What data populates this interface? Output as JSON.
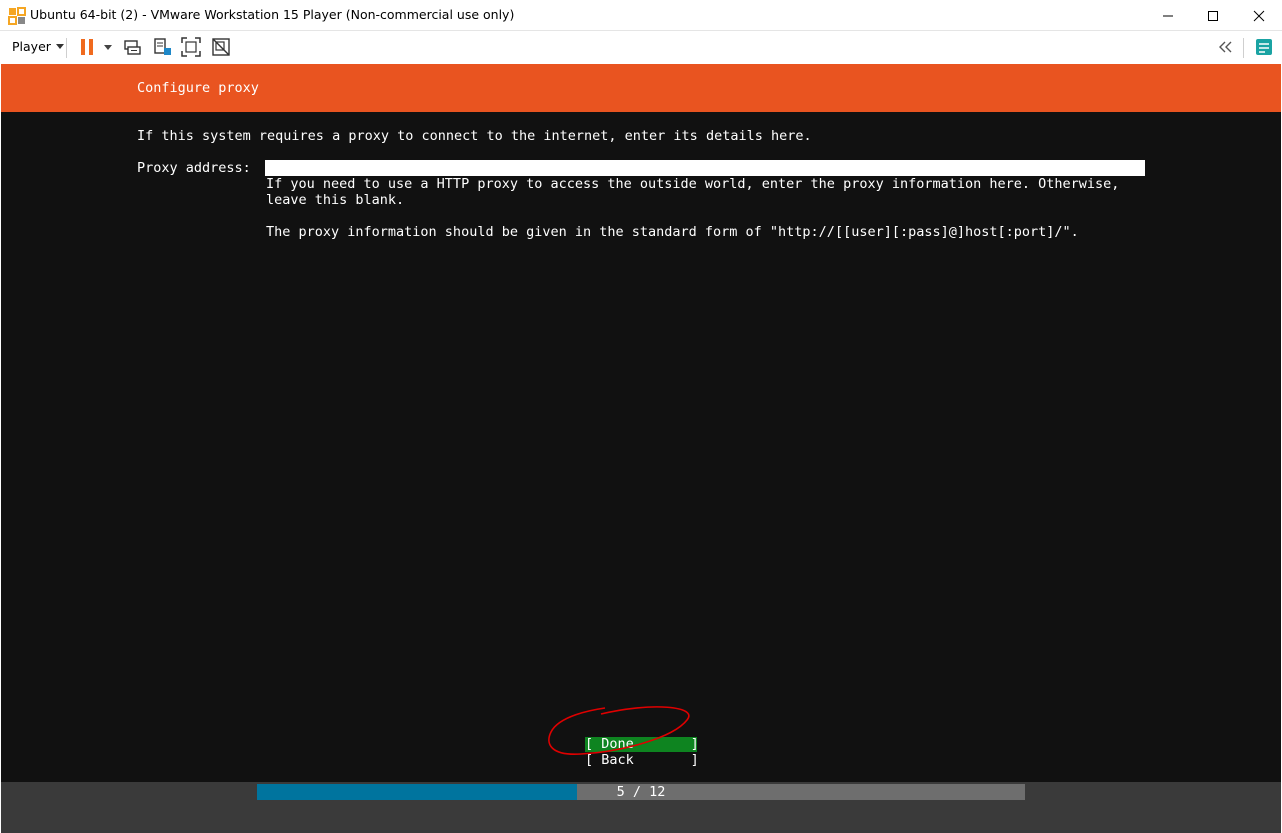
{
  "window": {
    "title": "Ubuntu 64-bit (2) - VMware Workstation 15 Player (Non-commercial use only)",
    "controls": [
      "minimize-icon",
      "maximize-icon",
      "close-icon"
    ]
  },
  "toolbar": {
    "player_menu": "Player",
    "icons": [
      "pause-icon",
      "dropdown-arrow-icon",
      "send-ctrl-alt-del-icon",
      "removable-devices-icon",
      "fullscreen-icon",
      "unity-icon",
      "collapse-icon",
      "library-icon"
    ]
  },
  "installer": {
    "header_title": "Configure proxy",
    "intro": "If this system requires a proxy to connect to the internet, enter its details here.",
    "field_label": "Proxy address:",
    "proxy_value": "",
    "help_line_1": "If you need to use a HTTP proxy to access the outside world, enter the proxy information here. Otherwise,",
    "help_line_2": "leave this blank.",
    "help_line_3": "The proxy information should be given in the standard form of \"http://[[user][:pass]@]host[:port]/\".",
    "done_button": "[ Done       ]",
    "back_button": "[ Back       ]",
    "progress": {
      "text": "5 / 12",
      "current": 5,
      "total": 12
    }
  },
  "colors": {
    "header": "#e95420",
    "screen_bg": "#111111",
    "done_bg": "#0e8420",
    "progress_fill": "#00749e",
    "annotation": "#e00000"
  }
}
